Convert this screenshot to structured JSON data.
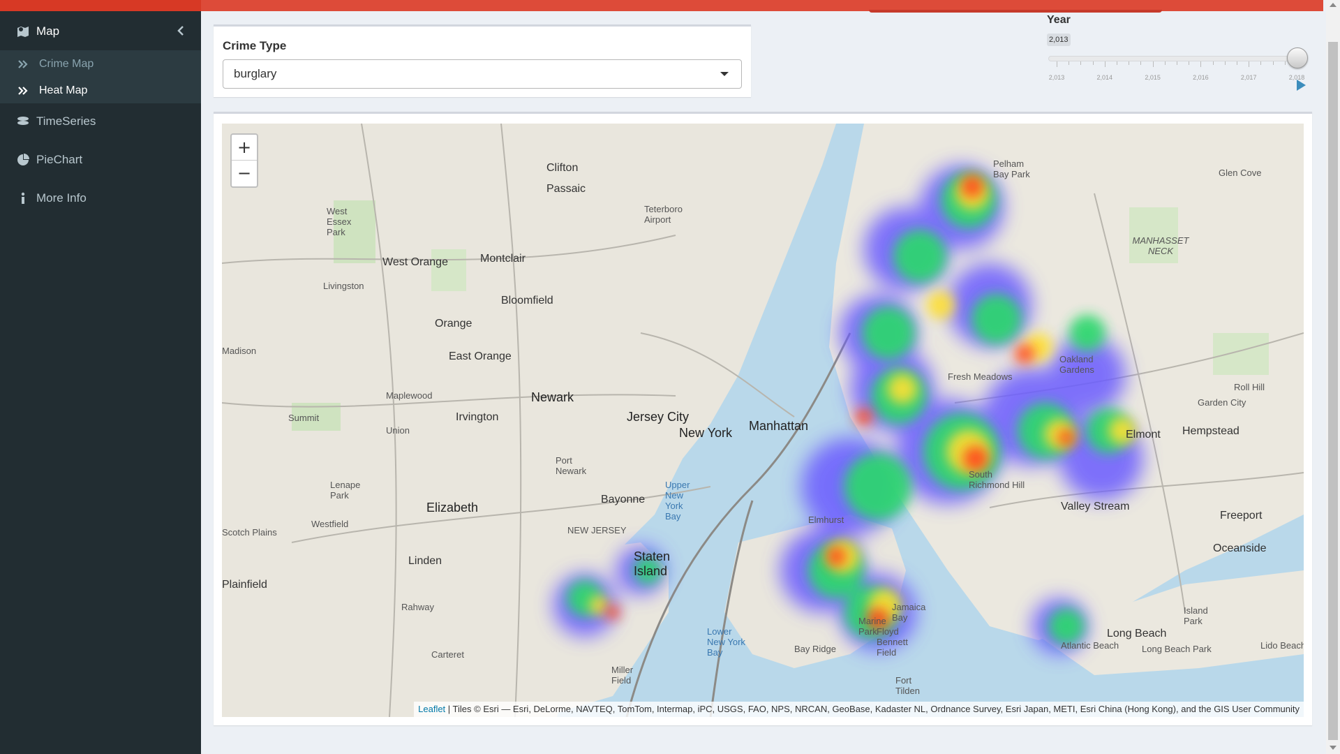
{
  "sidebar": {
    "items": [
      {
        "label": "Map",
        "icon": "map-icon"
      },
      {
        "label": "TimeSeries",
        "icon": "timeseries-icon"
      },
      {
        "label": "PieChart",
        "icon": "piechart-icon"
      },
      {
        "label": "More Info",
        "icon": "info-icon"
      }
    ],
    "submenu": [
      {
        "label": "Crime Map",
        "icon": "angle-double-right-icon"
      },
      {
        "label": "Heat Map",
        "icon": "angle-double-right-icon"
      }
    ],
    "collapse_icon": "chevron-left-icon"
  },
  "crime_type": {
    "label": "Crime Type",
    "selected": "burglary"
  },
  "year_slider": {
    "label": "Year",
    "value": "2,013",
    "ticks": [
      "2,013",
      "2,014",
      "2,015",
      "2,016",
      "2,017",
      "2,018"
    ],
    "play_icon": "play-icon"
  },
  "map": {
    "zoom_in": "+",
    "zoom_out": "−",
    "attribution_link": "Leaflet",
    "attribution_text": " | Tiles © Esri — Esri, DeLorme, NAVTEQ, TomTom, Intermap, iPC, USGS, FAO, NPS, NRCAN, GeoBase, Kadaster NL, Ordnance Survey, Esri Japan, METI, Esri China (Hong Kong), and the GIS User Community",
    "places": [
      "Clifton",
      "Passaic",
      "West Orange",
      "Montclair",
      "Livingston",
      "Bloomfield",
      "Orange",
      "East Orange",
      "Maplewood",
      "Newark",
      "Irvington",
      "Summit",
      "Jersey City",
      "New York",
      "Manhattan",
      "Elizabeth",
      "Bayonne",
      "Linden",
      "Rahway",
      "Carteret",
      "Plainfield",
      "Westfield",
      "Staten Island",
      "Glen Cove",
      "Elmont",
      "Hempstead",
      "Valley Stream",
      "Freeport",
      "Oceanside",
      "Long Beach",
      "Garden City",
      "Oakland Gardens",
      "Fresh Meadows",
      "South Richmond Hill",
      "Pelham Bay Park",
      "MANHASSET NECK",
      "Jamaica Bay",
      "NEW JERSEY",
      "Teterboro Airport",
      "West Essex Park",
      "Lenape Park",
      "Port Newark",
      "Upper New York Bay",
      "Lower New York Bay",
      "Marine Park",
      "Floyd Bennett Field",
      "Fort Tilden",
      "Atlantic Beach",
      "Long Beach Park",
      "Lido Beach",
      "Island Park",
      "Miller Field",
      "Roll Hill",
      "Union",
      "Scotch Plains",
      "Madison",
      "Elmhurst",
      "Bay Ridge"
    ]
  },
  "colors": {
    "header": "#dd4b39",
    "sidebar": "#222d32",
    "submenu": "#2c3b41",
    "content_bg": "#ecf0f5",
    "accent": "#3c8dbc"
  }
}
